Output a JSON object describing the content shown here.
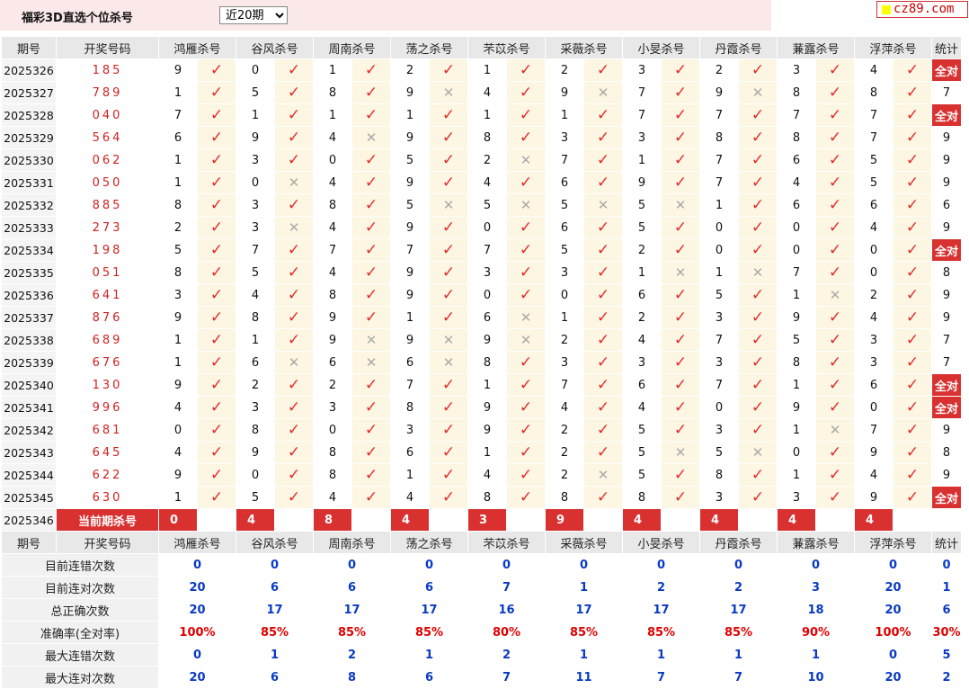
{
  "header": {
    "title": "福彩3D直选个位杀号",
    "period_selected": "近20期",
    "period_options": [
      "近20期"
    ],
    "logo_text": "cz89.com"
  },
  "columns": {
    "issue": "期号",
    "draw": "开奖号码",
    "experts": [
      "鸿雁杀号",
      "谷风杀号",
      "周南杀号",
      "荡之杀号",
      "芣苡杀号",
      "采薇杀号",
      "小旻杀号",
      "丹霞杀号",
      "蒹露杀号",
      "浮萍杀号"
    ],
    "stat": "统计"
  },
  "rows": [
    {
      "issue": "2025326",
      "draw": "185",
      "kills": [
        9,
        0,
        1,
        2,
        1,
        2,
        3,
        2,
        3,
        4
      ],
      "hits": [
        1,
        1,
        1,
        1,
        1,
        1,
        1,
        1,
        1,
        1
      ],
      "stat": "全对"
    },
    {
      "issue": "2025327",
      "draw": "789",
      "kills": [
        1,
        5,
        8,
        9,
        4,
        9,
        7,
        9,
        8,
        8
      ],
      "hits": [
        1,
        1,
        1,
        0,
        1,
        0,
        1,
        0,
        1,
        1
      ],
      "stat": "7"
    },
    {
      "issue": "2025328",
      "draw": "040",
      "kills": [
        7,
        1,
        1,
        1,
        1,
        1,
        7,
        7,
        7,
        7
      ],
      "hits": [
        1,
        1,
        1,
        1,
        1,
        1,
        1,
        1,
        1,
        1
      ],
      "stat": "全对"
    },
    {
      "issue": "2025329",
      "draw": "564",
      "kills": [
        6,
        9,
        4,
        9,
        8,
        3,
        3,
        8,
        8,
        7
      ],
      "hits": [
        1,
        1,
        0,
        1,
        1,
        1,
        1,
        1,
        1,
        1
      ],
      "stat": "9"
    },
    {
      "issue": "2025330",
      "draw": "062",
      "kills": [
        1,
        3,
        0,
        5,
        2,
        7,
        1,
        7,
        6,
        5
      ],
      "hits": [
        1,
        1,
        1,
        1,
        0,
        1,
        1,
        1,
        1,
        1
      ],
      "stat": "9"
    },
    {
      "issue": "2025331",
      "draw": "050",
      "kills": [
        1,
        0,
        4,
        9,
        4,
        6,
        9,
        7,
        4,
        5
      ],
      "hits": [
        1,
        0,
        1,
        1,
        1,
        1,
        1,
        1,
        1,
        1
      ],
      "stat": "9"
    },
    {
      "issue": "2025332",
      "draw": "885",
      "kills": [
        8,
        3,
        8,
        5,
        5,
        5,
        5,
        1,
        6,
        6
      ],
      "hits": [
        1,
        1,
        1,
        0,
        0,
        0,
        0,
        1,
        1,
        1
      ],
      "stat": "6"
    },
    {
      "issue": "2025333",
      "draw": "273",
      "kills": [
        2,
        3,
        4,
        9,
        0,
        6,
        5,
        0,
        0,
        4
      ],
      "hits": [
        1,
        0,
        1,
        1,
        1,
        1,
        1,
        1,
        1,
        1
      ],
      "stat": "9"
    },
    {
      "issue": "2025334",
      "draw": "198",
      "kills": [
        5,
        7,
        7,
        7,
        7,
        5,
        2,
        0,
        0,
        0
      ],
      "hits": [
        1,
        1,
        1,
        1,
        1,
        1,
        1,
        1,
        1,
        1
      ],
      "stat": "全对"
    },
    {
      "issue": "2025335",
      "draw": "051",
      "kills": [
        8,
        5,
        4,
        9,
        3,
        3,
        1,
        1,
        7,
        0
      ],
      "hits": [
        1,
        1,
        1,
        1,
        1,
        1,
        0,
        0,
        1,
        1
      ],
      "stat": "8"
    },
    {
      "issue": "2025336",
      "draw": "641",
      "kills": [
        3,
        4,
        8,
        9,
        0,
        0,
        6,
        5,
        1,
        2
      ],
      "hits": [
        1,
        1,
        1,
        1,
        1,
        1,
        1,
        1,
        0,
        1
      ],
      "stat": "9"
    },
    {
      "issue": "2025337",
      "draw": "876",
      "kills": [
        9,
        8,
        9,
        1,
        6,
        1,
        2,
        3,
        9,
        4
      ],
      "hits": [
        1,
        1,
        1,
        1,
        0,
        1,
        1,
        1,
        1,
        1
      ],
      "stat": "9"
    },
    {
      "issue": "2025338",
      "draw": "689",
      "kills": [
        1,
        1,
        9,
        9,
        9,
        2,
        4,
        7,
        5,
        3
      ],
      "hits": [
        1,
        1,
        0,
        0,
        0,
        1,
        1,
        1,
        1,
        1
      ],
      "stat": "7"
    },
    {
      "issue": "2025339",
      "draw": "676",
      "kills": [
        1,
        6,
        6,
        6,
        8,
        3,
        3,
        3,
        8,
        3
      ],
      "hits": [
        1,
        0,
        0,
        0,
        1,
        1,
        1,
        1,
        1,
        1
      ],
      "stat": "7"
    },
    {
      "issue": "2025340",
      "draw": "130",
      "kills": [
        9,
        2,
        2,
        7,
        1,
        7,
        6,
        7,
        1,
        6
      ],
      "hits": [
        1,
        1,
        1,
        1,
        1,
        1,
        1,
        1,
        1,
        1
      ],
      "stat": "全对"
    },
    {
      "issue": "2025341",
      "draw": "996",
      "kills": [
        4,
        3,
        3,
        8,
        9,
        4,
        4,
        0,
        9,
        0
      ],
      "hits": [
        1,
        1,
        1,
        1,
        1,
        1,
        1,
        1,
        1,
        1
      ],
      "stat": "全对"
    },
    {
      "issue": "2025342",
      "draw": "681",
      "kills": [
        0,
        8,
        0,
        3,
        9,
        2,
        5,
        3,
        1,
        7
      ],
      "hits": [
        1,
        1,
        1,
        1,
        1,
        1,
        1,
        1,
        0,
        1
      ],
      "stat": "9"
    },
    {
      "issue": "2025343",
      "draw": "645",
      "kills": [
        4,
        9,
        8,
        6,
        1,
        2,
        5,
        5,
        0,
        9
      ],
      "hits": [
        1,
        1,
        1,
        1,
        1,
        1,
        0,
        0,
        1,
        1
      ],
      "stat": "8"
    },
    {
      "issue": "2025344",
      "draw": "622",
      "kills": [
        9,
        0,
        8,
        1,
        4,
        2,
        5,
        8,
        1,
        4
      ],
      "hits": [
        1,
        1,
        1,
        1,
        1,
        0,
        1,
        1,
        1,
        1
      ],
      "stat": "9"
    },
    {
      "issue": "2025345",
      "draw": "630",
      "kills": [
        1,
        5,
        4,
        4,
        8,
        8,
        8,
        3,
        3,
        9
      ],
      "hits": [
        1,
        1,
        1,
        1,
        1,
        1,
        1,
        1,
        1,
        1
      ],
      "stat": "全对"
    }
  ],
  "current": {
    "issue": "2025346",
    "label": "当前期杀号",
    "kills": [
      0,
      4,
      8,
      4,
      3,
      9,
      4,
      4,
      4,
      4
    ]
  },
  "stats": [
    {
      "label": "目前连错次数",
      "values": [
        "0",
        "0",
        "0",
        "0",
        "0",
        "0",
        "0",
        "0",
        "0",
        "0",
        "0"
      ]
    },
    {
      "label": "目前连对次数",
      "values": [
        "20",
        "6",
        "6",
        "6",
        "7",
        "1",
        "2",
        "2",
        "3",
        "20",
        "1"
      ]
    },
    {
      "label": "总正确次数",
      "values": [
        "20",
        "17",
        "17",
        "17",
        "16",
        "17",
        "17",
        "17",
        "18",
        "20",
        "6"
      ]
    },
    {
      "label": "准确率(全对率)",
      "values": [
        "100%",
        "85%",
        "85%",
        "85%",
        "80%",
        "85%",
        "85%",
        "85%",
        "90%",
        "100%",
        "30%"
      ]
    },
    {
      "label": "最大连错次数",
      "values": [
        "0",
        "1",
        "2",
        "1",
        "2",
        "1",
        "1",
        "1",
        "1",
        "0",
        "5"
      ]
    },
    {
      "label": "最大连对次数",
      "values": [
        "20",
        "6",
        "8",
        "6",
        "7",
        "11",
        "7",
        "7",
        "10",
        "20",
        "2"
      ]
    }
  ],
  "colors": {
    "accent_red": "#d93030",
    "check": "#e32b2b",
    "stat_blue": "#0a3ac2",
    "header_pink": "#fbe9ea",
    "mark_bg": "#fcf6e3"
  },
  "icons": {
    "hit": "check-icon",
    "miss": "cross-icon"
  }
}
